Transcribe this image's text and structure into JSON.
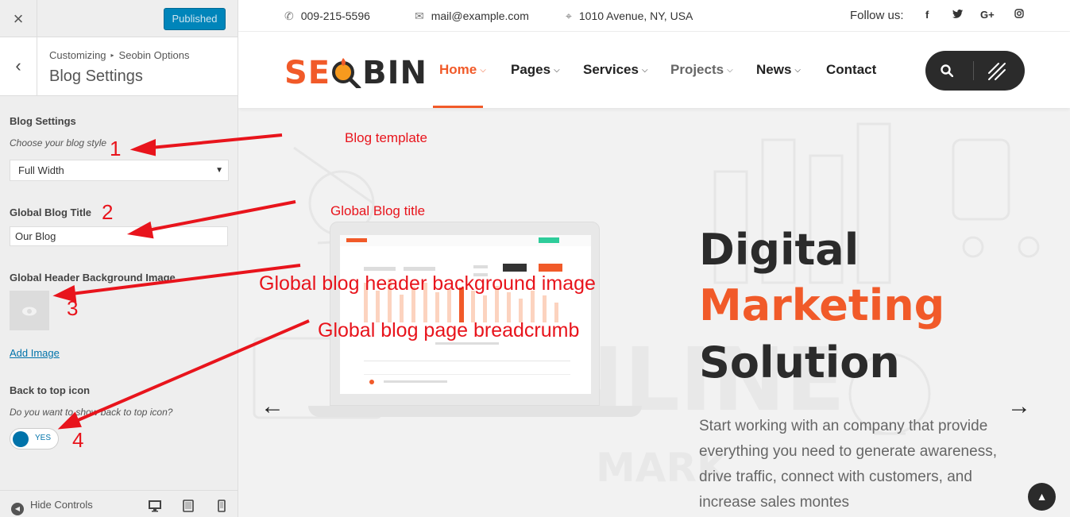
{
  "customizer": {
    "close_icon": "×",
    "publish_label": "Published",
    "breadcrumb": {
      "parent": "Customizing",
      "child": "Seobin Options"
    },
    "section_title": "Blog Settings",
    "blog_settings": {
      "label": "Blog Settings",
      "description": "Choose your blog style",
      "value": "Full Width"
    },
    "blog_title": {
      "label": "Global Blog Title",
      "value": "Our Blog"
    },
    "header_bg": {
      "label": "Global Header Background Image",
      "add_label": "Add Image"
    },
    "back_to_top": {
      "label": "Back to top icon",
      "description": "Do you want to show back to top icon?",
      "toggle_label": "YES",
      "enabled": true
    },
    "footer": {
      "hide_label": "Hide Controls"
    }
  },
  "site": {
    "topbar": {
      "phone": "009-215-5596",
      "email": "mail@example.com",
      "address": "1010 Avenue, NY, USA",
      "follow_label": "Follow us:",
      "social": [
        "f",
        "t",
        "G+",
        "ig"
      ]
    },
    "logo": {
      "part1": "SE",
      "part2": "BIN"
    },
    "nav": [
      {
        "label": "Home",
        "state": "active"
      },
      {
        "label": "Pages"
      },
      {
        "label": "Services"
      },
      {
        "label": "Projects",
        "state": "muted"
      },
      {
        "label": "News"
      },
      {
        "label": "Contact"
      }
    ],
    "hero": {
      "line1": "Digital",
      "line2": "Marketing",
      "line3": "Solution",
      "paragraph": "Start working with an company that provide everything you need to generate awareness, drive traffic, connect with customers, and increase sales montes",
      "prev_arrow": "←",
      "next_arrow": "→"
    },
    "colors": {
      "accent": "#f15a29",
      "dark": "#2b2b2b",
      "wp_blue": "#0085ba"
    }
  },
  "annotations": {
    "blog_template": "Blog template",
    "global_blog_title": "Global Blog title",
    "header_bg": "Global blog header background image",
    "breadcrumb": "Global blog page breadcrumb",
    "n1": "1",
    "n2": "2",
    "n3": "3",
    "n4": "4"
  }
}
